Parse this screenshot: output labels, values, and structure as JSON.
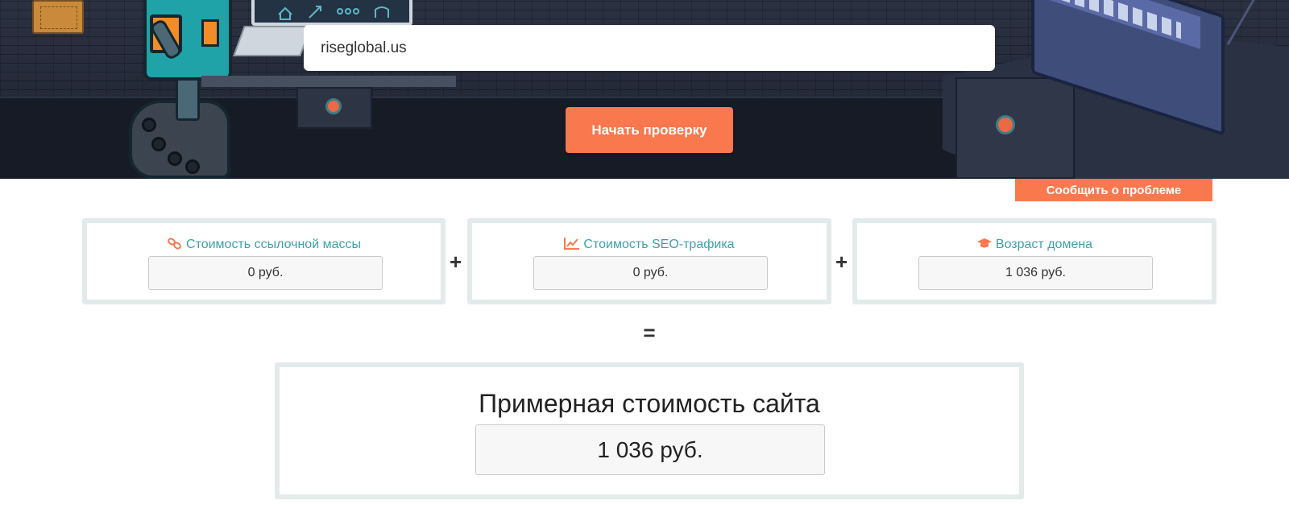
{
  "hero": {
    "url_value": "riseglobal.us",
    "start_button": "Начать проверку"
  },
  "report_button": "Сообщить о проблеме",
  "metrics": [
    {
      "label": "Стоимость ссылочной массы",
      "icon": "link-icon",
      "value": "0 руб."
    },
    {
      "label": "Стоимость SEO-трафика",
      "icon": "chart-line-icon",
      "value": "0 руб."
    },
    {
      "label": "Возраст домена",
      "icon": "graduation-cap-icon",
      "value": "1 036 руб."
    }
  ],
  "operators": {
    "plus": "+",
    "equals": "="
  },
  "total": {
    "title": "Примерная стоимость сайта",
    "value": "1 036 руб."
  },
  "colors": {
    "accent": "#f9784e",
    "label": "#3ca2aa",
    "hero_bg": "#1f2533",
    "card_border": "#e3ebea"
  }
}
